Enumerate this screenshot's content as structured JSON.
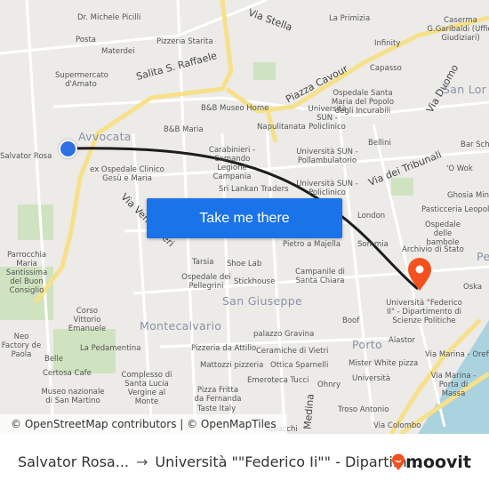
{
  "map": {
    "labels": [
      "Dr. Michele Picilli",
      "Posta",
      "Materdei",
      "Supermercato d'Amato",
      "Pizzeria Starita",
      "Salita S. Raffaele",
      "Via Stella",
      "La Primizia",
      "Caserma G.Garibaldi (Uffici Giudiziari)",
      "Infinity",
      "Capasso",
      "Piazza Cavour",
      "Via Duomo",
      "San Lor",
      "Ospedale Santa Maria del Popolo degli Incurabili",
      "B&B Museo Home",
      "B&B Maria",
      "Napulitanata",
      "Università SUN - Policlinico",
      "Avvocata",
      "Bar Schio",
      "Bellini",
      "Università SUN - Pollambulatorio",
      "Via dei Tribunali",
      "'O Wok",
      "Carabinieri - Comando Legione Campania",
      "ex Ospedale Clinico Gesù e Maria",
      "Salvator Rosa",
      "Università SUN - Policlinico",
      "Sri Lankan Traders",
      "Ghosia Mini",
      "Pasticceria Leopoldo",
      "Via Ventaglieri",
      "London",
      "Ospedale delle bambole",
      "Pietro a Majella",
      "Sommia",
      "Archivio di Stato",
      "Tarsia",
      "Shoe Lab",
      "Campanile di Santa Chiara",
      "Ospedale dei Pellegrini",
      "Stickhouse",
      "Oska",
      "Università \"Federico II\" - Dipartimento di Scienze Politiche",
      "San Giuseppe",
      "Corso Vittorio Emanuele",
      "Montecalvario",
      "Boof",
      "Porto",
      "palazzo Gravina",
      "Pizzeria da Attilio",
      "Ceramiche di Vietri",
      "Alastor",
      "La Pedamentina",
      "Belle",
      "Mattozzi pizzeria",
      "Ottica Sparnelli",
      "Mister White pizza",
      "Via Marina - Orefici",
      "Certosa Cafe",
      "Complesso di Santa Lucia Vergine al Monte",
      "Emeroteca Tucci",
      "Ohnry",
      "Università",
      "Via Marina - Porta di Massa",
      "Museo nazionale di San Martino",
      "Pizza Fritta da Fernanda",
      "Taste Italy",
      "Medina",
      "Troso Antonio",
      "Parrocchia Maria Santissima del Buon Consiglio",
      "Neo Factory de Paola",
      "Tabacchi",
      "Via Colombo",
      "Pe"
    ],
    "attribution": "© OpenStreetMap contributors | © OpenMapTiles",
    "cta_label": "Take me there",
    "origin_color": "#2f6fe4",
    "destination_color": "#f4511e",
    "route_color": "#1c1c1c"
  },
  "footer": {
    "from": "Salvator Rosa...",
    "arrow": "→",
    "to": "Università \"\"Federico Ii\"\" - Dipartim...",
    "brand": "moovit",
    "brand_color": "#f4511e"
  }
}
